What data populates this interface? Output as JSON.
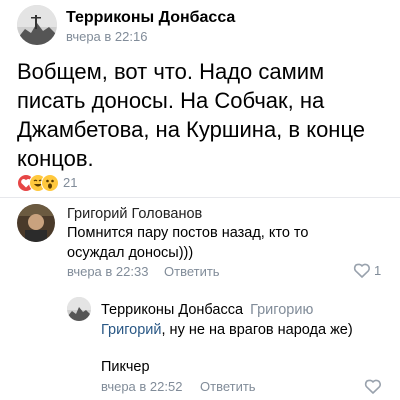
{
  "post": {
    "author": "Терриконы Донбасса",
    "time": "вчера в 22:16",
    "lines": [
      "Вобщем, вот что. Надо самим",
      "писать доносы. На Собчак, на",
      "Джамбетова, на Куршина, в конце",
      "концов."
    ],
    "reactions_count": "21",
    "reaction_icons": [
      "heart-reaction",
      "laugh-reaction",
      "wow-reaction"
    ]
  },
  "comments": [
    {
      "author": "Григорий Голованов",
      "lines": [
        "Помнится пару постов назад, кто то",
        "осуждал доносы)))"
      ],
      "time": "вчера в 22:33",
      "reply_label": "Ответить",
      "likes": "1"
    },
    {
      "author": "Терриконы Донбасса",
      "reply_to": "Григорию",
      "mention": "Григорий",
      "text": ", ну не на врагов народа же)",
      "text2": "Пикчер",
      "time": "вчера в 22:52",
      "reply_label": "Ответить"
    }
  ],
  "colors": {
    "link": "#2a5885",
    "meta": "#818c99",
    "heart": "#e64646"
  }
}
